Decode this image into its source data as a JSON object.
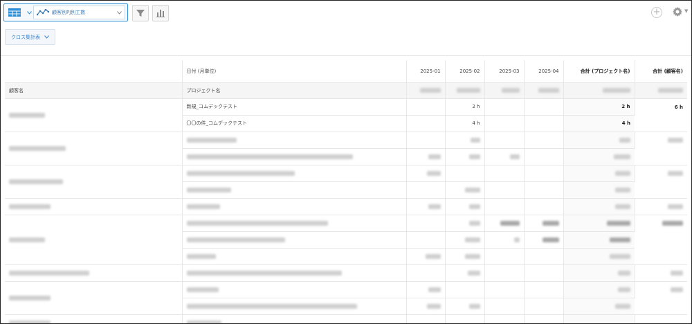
{
  "toolbar": {
    "view_name": "顧客別PJ別工数",
    "icons": [
      "grid-icon",
      "line-chart-icon",
      "filter-icon",
      "bar-chart-icon",
      "plus-icon",
      "gear-icon"
    ]
  },
  "cross_tab_button": {
    "label": "クロス集計表"
  },
  "table": {
    "header_row1": {
      "date_label": "日付 (月単位)",
      "months": [
        "2025-01",
        "2025-02",
        "2025-03",
        "2025-04"
      ],
      "total_project": "合計 (プロジェクト名)",
      "total_customer": "合計 (顧客名)"
    },
    "header_row2": {
      "customer_label": "顧客名",
      "project_label": "プロジェクト名"
    },
    "rows": [
      {
        "project": "新規_コムデックテスト",
        "m2": "2 h",
        "total_project": "2 h",
        "total_customer": "6 h"
      },
      {
        "project": "〇〇の件_コムデックテスト",
        "m2": "4 h",
        "total_project": "4 h"
      }
    ]
  },
  "colors": {
    "accent": "#2e8fd6",
    "link": "#3b7fc4"
  }
}
